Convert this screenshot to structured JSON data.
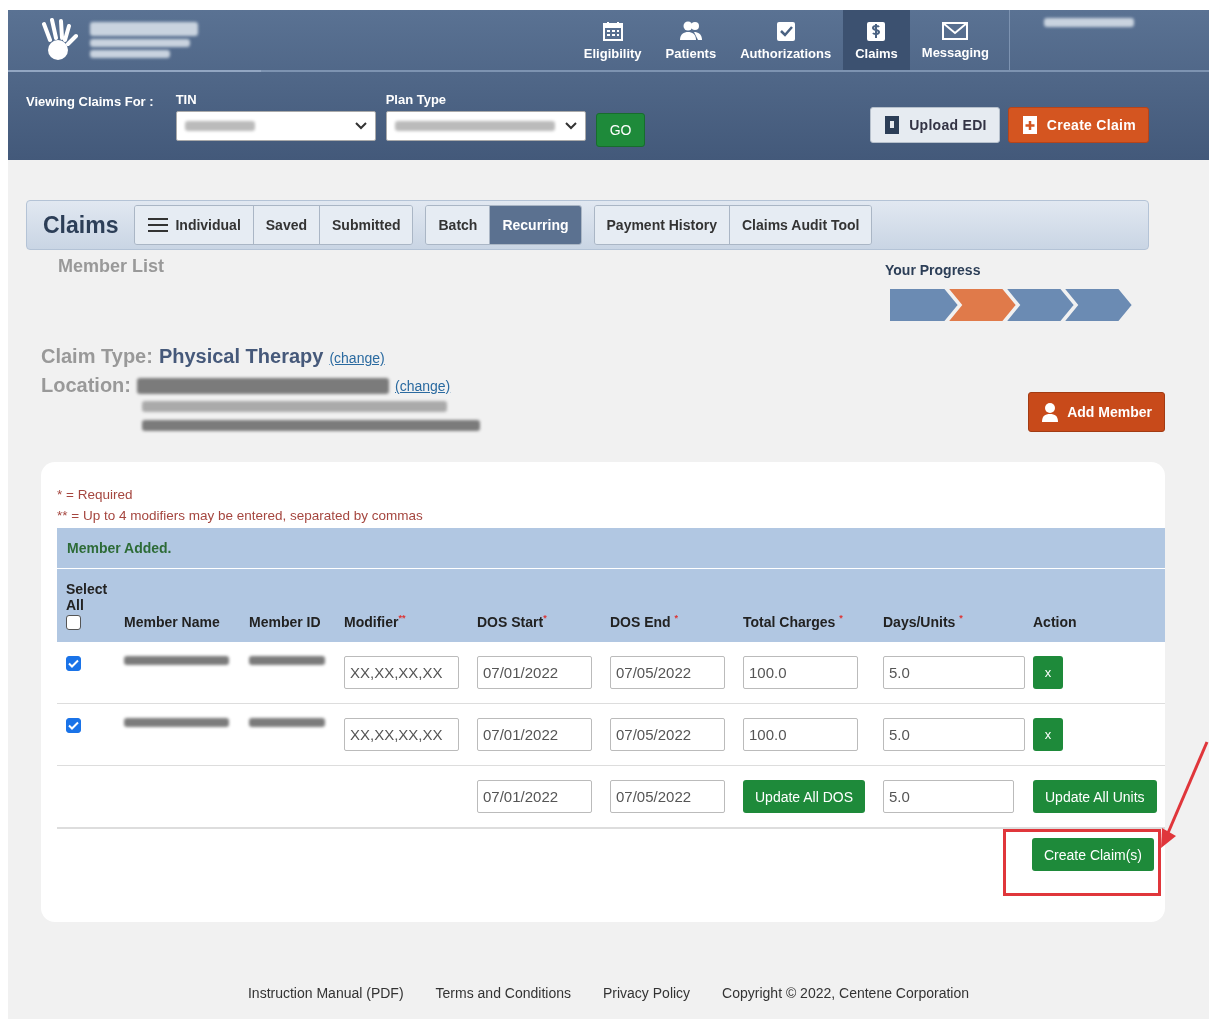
{
  "nav": {
    "items": [
      {
        "label": "Eligibility",
        "selected": false
      },
      {
        "label": "Patients",
        "selected": false
      },
      {
        "label": "Authorizations",
        "selected": false
      },
      {
        "label": "Claims",
        "selected": true
      },
      {
        "label": "Messaging",
        "selected": false
      }
    ]
  },
  "toolbar": {
    "viewing_label": "Viewing Claims For :",
    "tin_label": "TIN",
    "plan_type_label": "Plan Type",
    "go_button": "GO",
    "upload_button": "Upload EDI",
    "create_button": "Create Claim"
  },
  "claims_bar": {
    "title": "Claims",
    "groups": [
      [
        {
          "label": "Individual",
          "selected": false
        },
        {
          "label": "Saved",
          "selected": false
        },
        {
          "label": "Submitted",
          "selected": false
        }
      ],
      [
        {
          "label": "Batch",
          "selected": false
        },
        {
          "label": "Recurring",
          "selected": true
        }
      ],
      [
        {
          "label": "Payment History",
          "selected": false
        },
        {
          "label": "Claims Audit Tool",
          "selected": false
        }
      ]
    ]
  },
  "subtitle": "Member List",
  "progress": {
    "label": "Your Progress",
    "steps": [
      {
        "selected": false
      },
      {
        "selected": true
      },
      {
        "selected": false
      },
      {
        "selected": false
      }
    ]
  },
  "claim_type": {
    "label": "Claim Type:",
    "value": "Physical Therapy",
    "change_link": "(change)"
  },
  "location": {
    "label": "Location:",
    "change_link": "(change)"
  },
  "add_member_button": "Add Member",
  "notes": [
    "* = Required",
    "** = Up to 4 modifiers may be entered, separated by commas"
  ],
  "alert": "Member Added.",
  "table": {
    "select_all": {
      "label": "Select All",
      "checked": false
    },
    "columns": [
      "Member Name",
      "Member ID",
      "Modifier$^{**}$",
      "DOS Start$^{*}$",
      "DOS End $^{*}$",
      "Total Charges $^{*}$",
      "Days/Units $^{*}$",
      "Action"
    ],
    "rows": [
      {
        "checked": true,
        "modifier_placeholder": "XX,XX,XX,XX",
        "dos_start": "07/01/2022",
        "dos_end": "07/05/2022",
        "total_charges": "100.0",
        "days_units": "5.0",
        "action": "x"
      },
      {
        "checked": true,
        "modifier_placeholder": "XX,XX,XX,XX",
        "dos_start": "07/01/2022",
        "dos_end": "07/05/2022",
        "total_charges": "100.0",
        "days_units": "5.0",
        "action": "x"
      }
    ],
    "bulk": {
      "dos_start": "07/01/2022",
      "dos_end": "07/05/2022",
      "update_dos_button": "Update All DOS",
      "days_units": "5.0",
      "update_units_button": "Update All Units"
    }
  },
  "create_claims_button": "Create Claim(s)",
  "footer": [
    "Instruction Manual (PDF)",
    "Terms and Conditions",
    "Privacy Policy",
    "Copyright © 2022, Centene Corporation"
  ]
}
